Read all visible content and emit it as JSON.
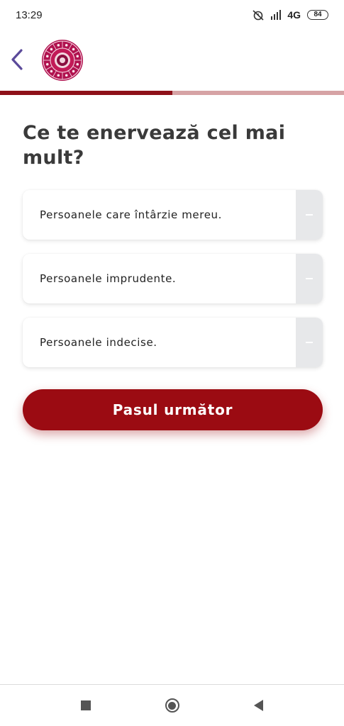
{
  "status_bar": {
    "time": "13:29",
    "network": "4G",
    "battery": "84"
  },
  "header": {
    "back_icon": "chevron-left-icon",
    "logo_icon": "zodiac-wheel-icon"
  },
  "progress": {
    "value": 0.5
  },
  "question": {
    "text": "Ce te enervează cel mai mult?"
  },
  "options": [
    {
      "label": "Persoanele care întârzie mereu."
    },
    {
      "label": "Persoanele imprudente."
    },
    {
      "label": "Persoanele indecise."
    }
  ],
  "next_button": {
    "label": "Pasul următor"
  },
  "colors": {
    "accent": "#9b0b12",
    "progress_track": "#d6a3a5",
    "back_arrow": "#5b4a9a"
  }
}
